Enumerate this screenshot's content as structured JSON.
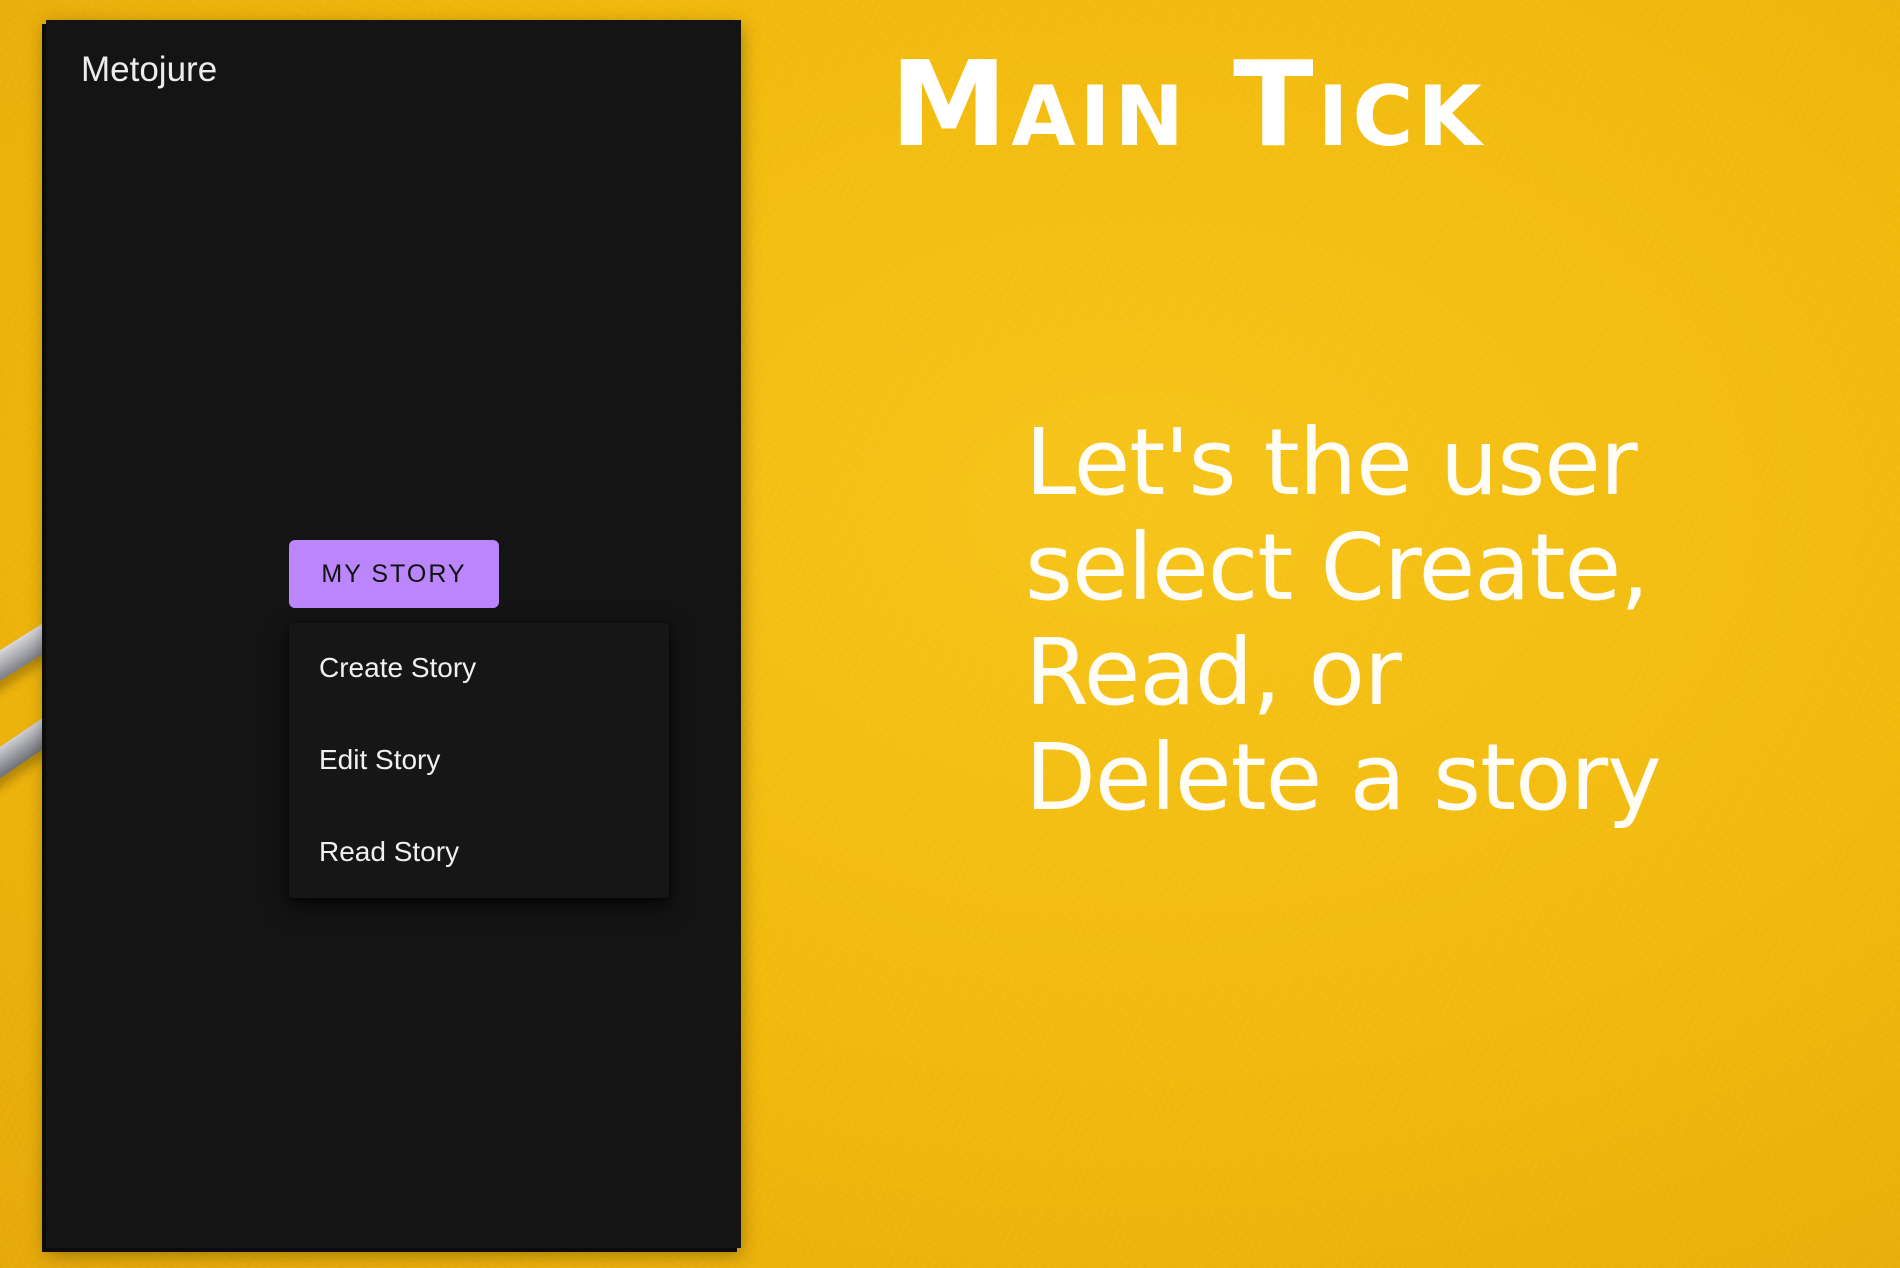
{
  "background": {
    "color": "#f2b90c"
  },
  "app": {
    "title": "Metojure"
  },
  "menu_button": {
    "label": "MY STORY",
    "color": "#bb86fc"
  },
  "dropdown": {
    "items": [
      {
        "label": "Create Story"
      },
      {
        "label": "Edit Story"
      },
      {
        "label": "Read Story"
      }
    ]
  },
  "headline": "Main Tick",
  "description": {
    "lines": [
      "Let's the user",
      "select Create,",
      "Read, or",
      "Delete a story"
    ]
  }
}
